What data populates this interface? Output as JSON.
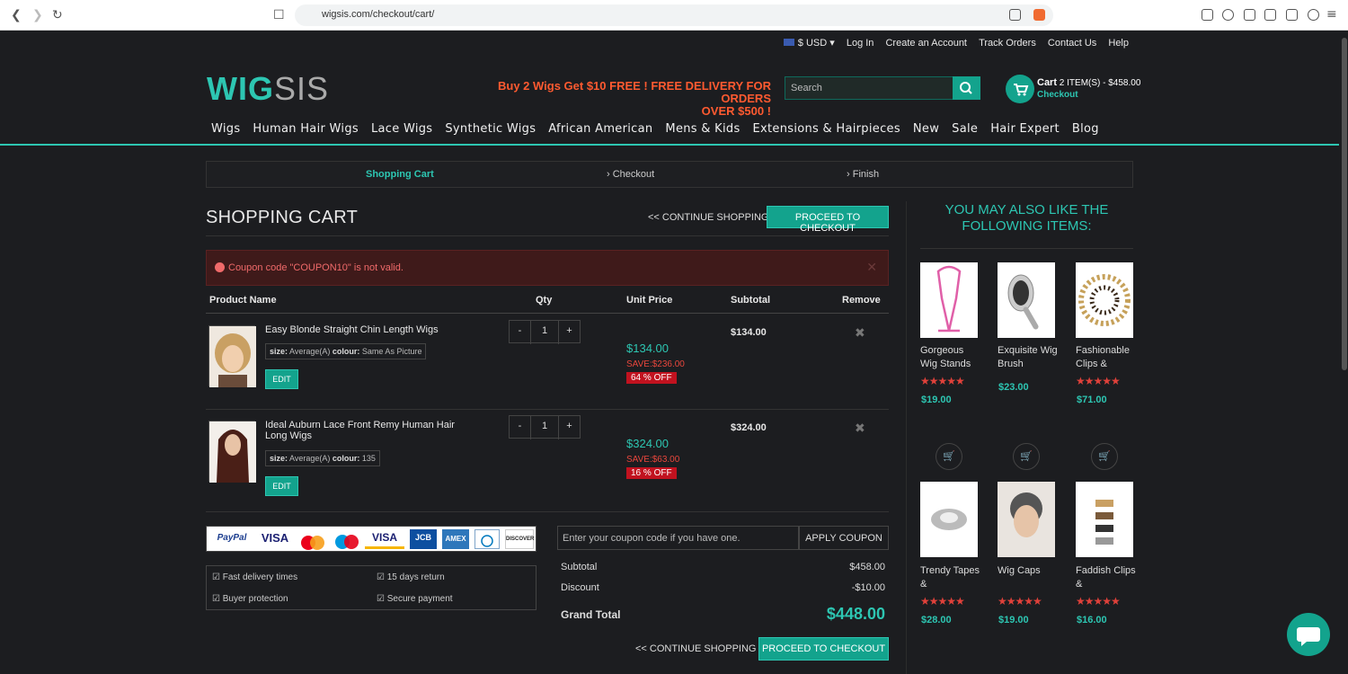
{
  "browser": {
    "url": "wigsis.com/checkout/cart/"
  },
  "topbar": {
    "currency": "$ USD",
    "links": [
      "Log In",
      "Create an Account",
      "Track Orders",
      "Contact Us",
      "Help"
    ]
  },
  "header": {
    "logo_a": "WIG",
    "logo_b": "SIS",
    "promo_line1": "Buy 2 Wigs Get $10 FREE ! FREE DELIVERY FOR ORDERS",
    "promo_line2": "OVER $500 !",
    "search_placeholder": "Search",
    "cart_label": "Cart",
    "cart_summary": "2 ITEM(S) - $458.00",
    "cart_checkout": "Checkout"
  },
  "nav": [
    "Wigs",
    "Human Hair Wigs",
    "Lace Wigs",
    "Synthetic Wigs",
    "African American",
    "Mens & Kids",
    "Extensions & Hairpieces",
    "New",
    "Sale",
    "Hair Expert",
    "Blog"
  ],
  "steps": [
    "Shopping Cart",
    "Checkout",
    "Finish"
  ],
  "cart": {
    "title": "SHOPPING CART",
    "continue": "<< CONTINUE SHOPPING",
    "proceed": "PROCEED TO CHECKOUT",
    "alert": "Coupon code \"COUPON10\" is not valid.",
    "columns": [
      "Product Name",
      "Qty",
      "Unit Price",
      "Subtotal",
      "Remove"
    ],
    "items": [
      {
        "name": "Easy Blonde Straight Chin Length Wigs",
        "size_label": "size:",
        "size": "Average(A)",
        "colour_label": "colour:",
        "colour": "Same As Picture",
        "edit": "EDIT",
        "qty": "1",
        "price": "$134.00",
        "save": "SAVE:$236.00",
        "off": "64 % OFF",
        "subtotal": "$134.00"
      },
      {
        "name": "Ideal Auburn Lace Front Remy Human Hair Long Wigs",
        "size_label": "size:",
        "size": "Average(A)",
        "colour_label": "colour:",
        "colour": "135",
        "edit": "EDIT",
        "qty": "1",
        "price": "$324.00",
        "save": "SAVE:$63.00",
        "off": "16 % OFF",
        "subtotal": "$324.00"
      }
    ],
    "payments": [
      "PayPal",
      "VISA",
      "",
      "",
      "VISA",
      "JCB",
      "AMEX",
      "",
      "DISCOVER"
    ],
    "features": [
      "Fast delivery times",
      "15 days return",
      "Buyer protection",
      "Secure payment"
    ],
    "coupon_placeholder": "Enter your coupon code if you have one.",
    "apply": "APPLY COUPON",
    "subtotal_label": "Subtotal",
    "subtotal": "$458.00",
    "discount_label": "Discount",
    "discount": "-$10.00",
    "grand_label": "Grand Total",
    "grand": "$448.00"
  },
  "sidebar": {
    "heading_line1": "YOU MAY ALSO LIKE THE",
    "heading_line2": "FOLLOWING ITEMS:",
    "items": [
      {
        "name": "Gorgeous Wig Stands",
        "price": "$19.00",
        "stars": "★★★★★"
      },
      {
        "name": "Exquisite Wig Brush",
        "price": "$23.00",
        "stars": ""
      },
      {
        "name": "Fashionable Clips &",
        "price": "$71.00",
        "stars": "★★★★★"
      },
      {
        "name": "Trendy Tapes &",
        "price": "$28.00",
        "stars": "★★★★★"
      },
      {
        "name": "Wig Caps",
        "price": "$19.00",
        "stars": "★★★★★"
      },
      {
        "name": "Faddish Clips &",
        "price": "$16.00",
        "stars": "★★★★★"
      }
    ]
  }
}
